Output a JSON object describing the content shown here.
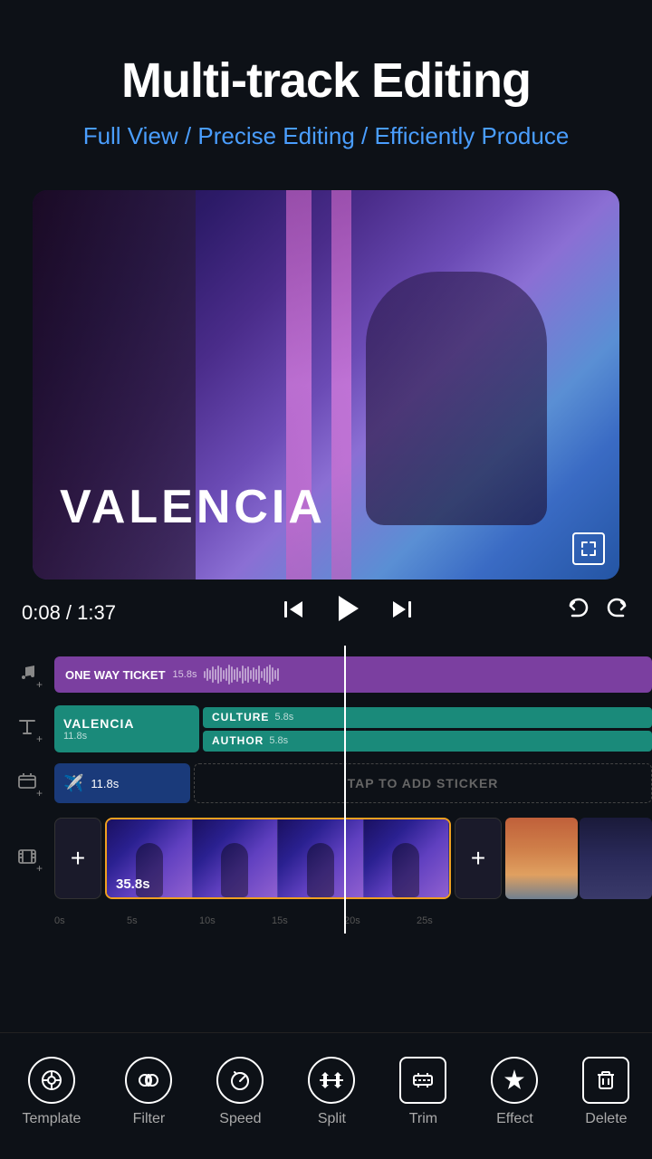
{
  "header": {
    "main_title": "Multi-track Editing",
    "sub_title": "Full View / Precise Editing / Efficiently Produce"
  },
  "video_preview": {
    "title_text": "VALENCIA",
    "time_current": "0:08",
    "time_total": "1:37",
    "time_display": "0:08 / 1:37"
  },
  "tracks": {
    "audio": {
      "label": "ONE WAY TICKET",
      "duration": "15.8s"
    },
    "text_main": {
      "label": "VALENCIA",
      "duration": "11.8s"
    },
    "text_sub1": {
      "label": "CULTURE",
      "duration": "5.8s"
    },
    "text_sub2": {
      "label": "AUTHOR",
      "duration": "5.8s"
    },
    "sticker": {
      "duration": "11.8s"
    },
    "sticker_add": {
      "label": "TAP TO ADD STICKER"
    },
    "video_main": {
      "duration": "35.8s"
    }
  },
  "ruler": {
    "marks": [
      "0s",
      "5s",
      "10s",
      "15s",
      "20s",
      "25s"
    ]
  },
  "bottom_nav": {
    "items": [
      {
        "label": "Template",
        "icon": "⊙"
      },
      {
        "label": "Filter",
        "icon": "⬡"
      },
      {
        "label": "Speed",
        "icon": "◎"
      },
      {
        "label": "Split",
        "icon": "✂"
      },
      {
        "label": "Trim",
        "icon": "<>"
      },
      {
        "label": "Effect",
        "icon": "✦"
      },
      {
        "label": "Delete",
        "icon": "🗑"
      }
    ]
  }
}
